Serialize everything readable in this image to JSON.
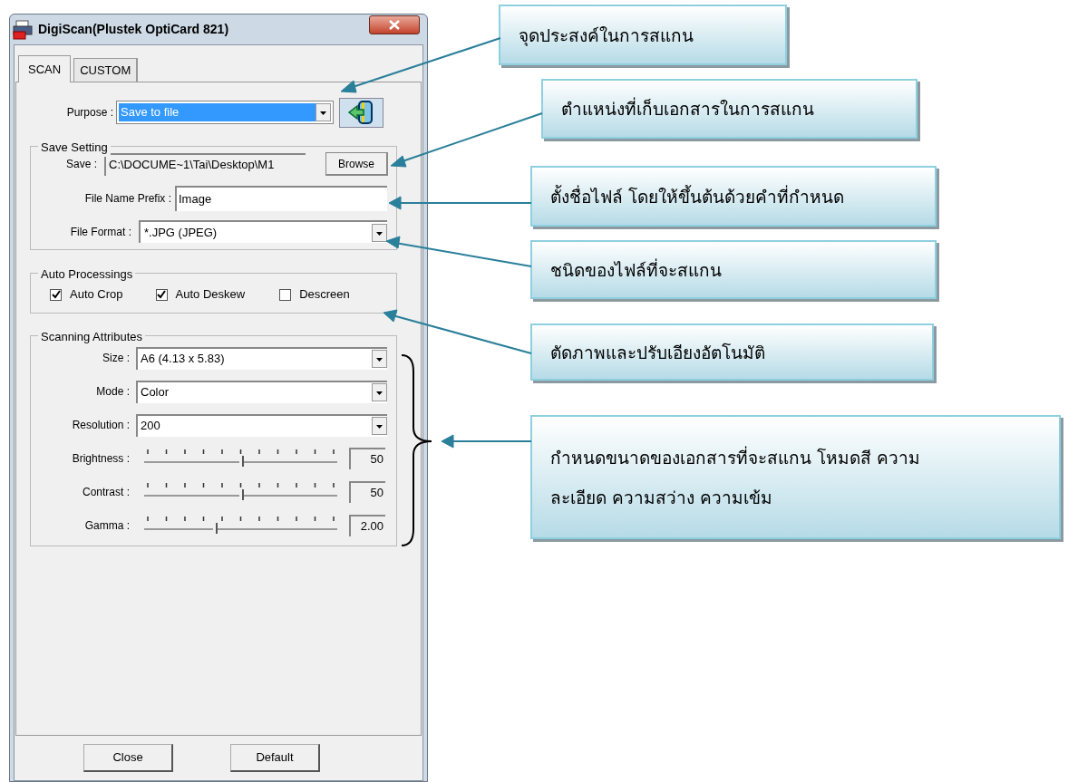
{
  "window": {
    "title": "DigiScan(Plustek OptiCard 821)"
  },
  "tabs": [
    {
      "label": "SCAN",
      "selected": true
    },
    {
      "label": "CUSTOM",
      "selected": false
    }
  ],
  "purpose": {
    "label": "Purpose :",
    "value": "Save to file",
    "focused": true
  },
  "save_setting": {
    "title": "Save Setting",
    "save_label": "Save :",
    "save_path": "C:\\DOCUME~1\\Tai\\Desktop\\M1",
    "browse": "Browse",
    "prefix_label": "File Name Prefix :",
    "prefix": "Image",
    "format_label": "File Format :",
    "format": "*.JPG (JPEG)"
  },
  "auto_processings": {
    "title": "Auto Processings",
    "options": [
      {
        "label": "Auto Crop",
        "checked": true
      },
      {
        "label": "Auto Deskew",
        "checked": true
      },
      {
        "label": "Descreen",
        "checked": false
      }
    ]
  },
  "scanning_attributes": {
    "title": "Scanning Attributes",
    "fields": [
      {
        "kind": "combo",
        "label": "Size :",
        "value": "A6 (4.13 x 5.83)"
      },
      {
        "kind": "combo",
        "label": "Mode :",
        "value": "Color"
      },
      {
        "kind": "combo",
        "label": "Resolution :",
        "value": "200"
      },
      {
        "kind": "slider",
        "label": "Brightness :",
        "level": 0.5,
        "reading": "50"
      },
      {
        "kind": "slider",
        "label": "Contrast :",
        "level": 0.5,
        "reading": "50"
      },
      {
        "kind": "slider",
        "label": "Gamma :",
        "level": 0.36,
        "reading": "2.00"
      }
    ]
  },
  "buttons": [
    "Close",
    "Default"
  ],
  "callouts": [
    {
      "lines": [
        "จุดประสงค์ในการสแกน"
      ]
    },
    {
      "lines": [
        "ตำแหน่งที่เก็บเอกสารในการสแกน"
      ]
    },
    {
      "lines": [
        "ตั้งชื่อไฟล์ โดยให้ขึ้นต้นด้วยคำที่กำหนด"
      ]
    },
    {
      "lines": [
        "ชนิดของไฟล์ที่จะสแกน"
      ]
    },
    {
      "lines": [
        "ตัดภาพและปรับเอียงอัตโนมัติ"
      ]
    },
    {
      "lines": [
        "กำหนดขนาดของเอกสารที่จะสแกน โหมดสี ความ",
        "ละเอียด ความสว่าง ความเข้ม"
      ]
    }
  ]
}
